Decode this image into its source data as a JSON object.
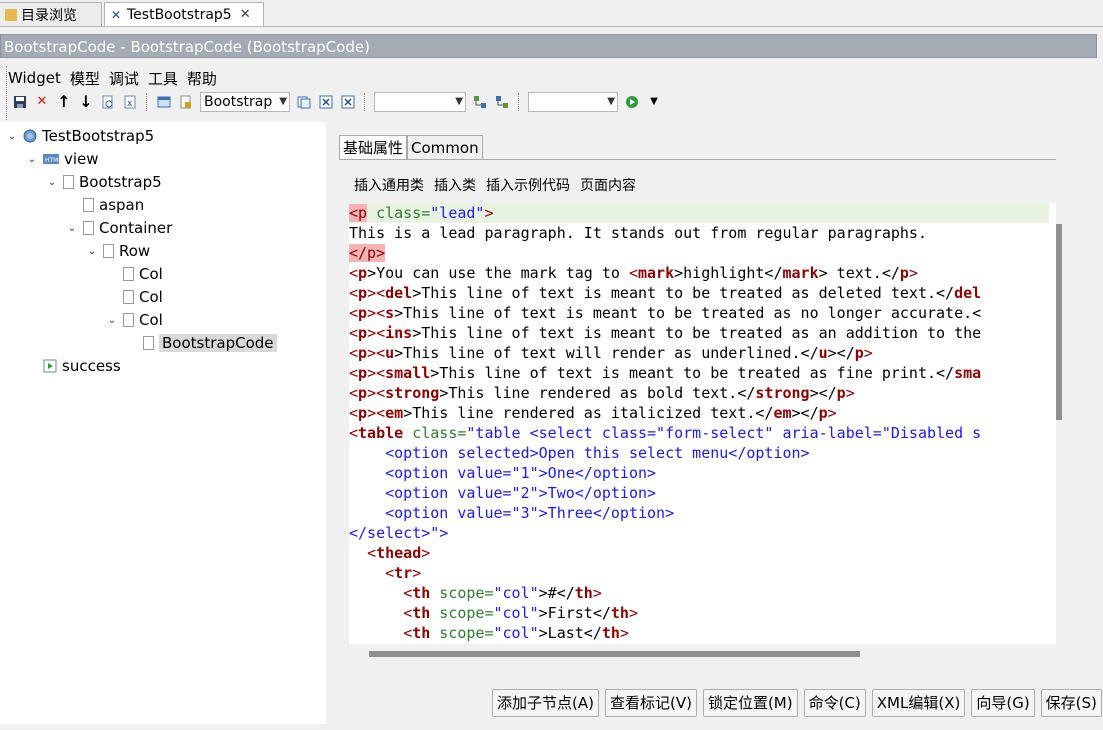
{
  "tabs": [
    {
      "label": "目录浏览",
      "icon": "folder-icon"
    },
    {
      "label": "TestBootstrap5",
      "icon": "xml-icon",
      "close": "✕"
    }
  ],
  "window": {
    "title": "BootstrapCode - BootstrapCode  (BootstrapCode)"
  },
  "menu": [
    "Widget",
    "模型",
    "调试",
    "工具",
    "帮助"
  ],
  "toolbar": {
    "combo1_value": "Bootstrap",
    "combo2_value": "",
    "combo3_value": ""
  },
  "tree": [
    {
      "label": "TestBootstrap5",
      "icon": "globe-icon",
      "expanded": true
    },
    {
      "label": "view",
      "icon": "html-icon",
      "expanded": true
    },
    {
      "label": "Bootstrap5",
      "icon": "page-icon",
      "expanded": true
    },
    {
      "label": "aspan",
      "icon": "page-icon"
    },
    {
      "label": "Container",
      "icon": "page-icon",
      "expanded": true
    },
    {
      "label": "Row",
      "icon": "page-icon",
      "expanded": true
    },
    {
      "label": "Col",
      "icon": "page-icon"
    },
    {
      "label": "Col",
      "icon": "page-icon"
    },
    {
      "label": "Col",
      "icon": "page-icon",
      "expanded": true
    },
    {
      "label": "BootstrapCode",
      "icon": "page-icon",
      "selected": true
    },
    {
      "label": "success",
      "icon": "play-page-icon"
    }
  ],
  "panel_tabs": [
    "基础属性",
    "Common"
  ],
  "insert_links": [
    "插入通用类",
    "插入类",
    "插入示例代码",
    "页面内容"
  ],
  "code": {
    "l1": {
      "p_open": "<p",
      "attr": " class=",
      "val": "\"lead\"",
      "close": ">"
    },
    "l2": "This is a lead paragraph. It stands out from regular paragraphs.",
    "l3": "</p>",
    "l4": {
      "a": "<",
      "b": "p",
      "c": ">You can use the mark tag to ",
      "d": "<",
      "e": "mark",
      "f": ">highlight</",
      "g": "mark",
      "h": "> text.</",
      "i": "p",
      "j": ">"
    },
    "l5": {
      "a": "<",
      "b": "p",
      "c": "><",
      "d": "del",
      "e": ">This line of text is meant to be treated as deleted text.</",
      "f": "del"
    },
    "l6": {
      "a": "<",
      "b": "p",
      "c": "><",
      "d": "s",
      "e": ">This line of text is meant to be treated as no longer accurate.<"
    },
    "l7": {
      "a": "<",
      "b": "p",
      "c": "><",
      "d": "ins",
      "e": ">This line of text is meant to be treated as an addition to the"
    },
    "l8": {
      "a": "<",
      "b": "p",
      "c": "><",
      "d": "u",
      "e": ">This line of text will render as underlined.</",
      "f": "u",
      "g": "></",
      "h": "p",
      "i": ">"
    },
    "l9": {
      "a": "<",
      "b": "p",
      "c": "><",
      "d": "small",
      "e": ">This line of text is meant to be treated as fine print.</",
      "f": "sma"
    },
    "l10": {
      "a": "<",
      "b": "p",
      "c": "><",
      "d": "strong",
      "e": ">This line rendered as bold text.</",
      "f": "strong",
      "g": "></",
      "h": "p",
      "i": ">"
    },
    "l11": {
      "a": "<",
      "b": "p",
      "c": "><",
      "d": "em",
      "e": ">This line rendered as italicized text.</",
      "f": "em",
      "g": "></",
      "h": "p",
      "i": ">"
    },
    "l12": {
      "a": "<",
      "b": "table",
      "c": " class=",
      "d": "\"table <select class=\"form-select\" aria-label=\"Disabled s"
    },
    "l13": "    <option selected>Open this select menu</option>",
    "l14": "    <option value=\"1\">One</option>",
    "l15": "    <option value=\"2\">Two</option>",
    "l16": "    <option value=\"3\">Three</option>",
    "l17": "</select>\">",
    "l18": {
      "ind": "  ",
      "a": "<",
      "b": "thead",
      "c": ">"
    },
    "l19": {
      "ind": "    ",
      "a": "<",
      "b": "tr",
      "c": ">"
    },
    "l20": {
      "ind": "      ",
      "a": "<",
      "b": "th",
      "c": " scope=",
      "d": "\"col\"",
      "e": ">#</",
      "f": "th",
      "g": ">"
    },
    "l21": {
      "ind": "      ",
      "a": "<",
      "b": "th",
      "c": " scope=",
      "d": "\"col\"",
      "e": ">First</",
      "f": "th",
      "g": ">"
    },
    "l22": {
      "ind": "      ",
      "a": "<",
      "b": "th",
      "c": " scope=",
      "d": "\"col\"",
      "e": ">Last</",
      "f": "th",
      "g": ">"
    }
  },
  "buttons": [
    "添加子节点(A)",
    "查看标记(V)",
    "锁定位置(M)",
    "命令(C)",
    "XML编辑(X)",
    "向导(G)",
    "保存(S)"
  ]
}
